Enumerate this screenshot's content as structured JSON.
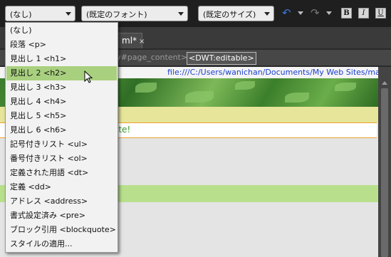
{
  "toolbar": {
    "format_select": "(なし)",
    "font_select": "(既定のフォント)",
    "size_select": "(既定のサイズ)",
    "bold_label": "B",
    "italic_label": "I",
    "underline_label": "U"
  },
  "tab": {
    "label": "ml*",
    "close": "×"
  },
  "tagbar": {
    "tag_page": "iv#page_content>",
    "tag_editable": "<DWT:editable>"
  },
  "path_bar": {
    "url": "file:///C:/Users/wanichan/Documents/My Web Sites/master.dwt"
  },
  "design": {
    "edit_text": "ite!"
  },
  "menu": {
    "highlighted_index": 3,
    "items": [
      "(なし)",
      "段落 <p>",
      "見出し 1 <h1>",
      "見出し 2 <h2>",
      "見出し 3 <h3>",
      "見出し 4 <h4>",
      "見出し 5 <h5>",
      "見出し 6 <h6>",
      "記号付きリスト <ul>",
      "番号付きリスト <ol>",
      "定義された用語 <dt>",
      "定義 <dd>",
      "アドレス <address>",
      "書式設定済み <pre>",
      "ブロック引用 <blockquote>",
      "スタイルの適用..."
    ]
  },
  "colors": {
    "highlight": "#a9d07e",
    "path_link": "#1a3fcf",
    "undo_icon": "#3a78d8"
  }
}
